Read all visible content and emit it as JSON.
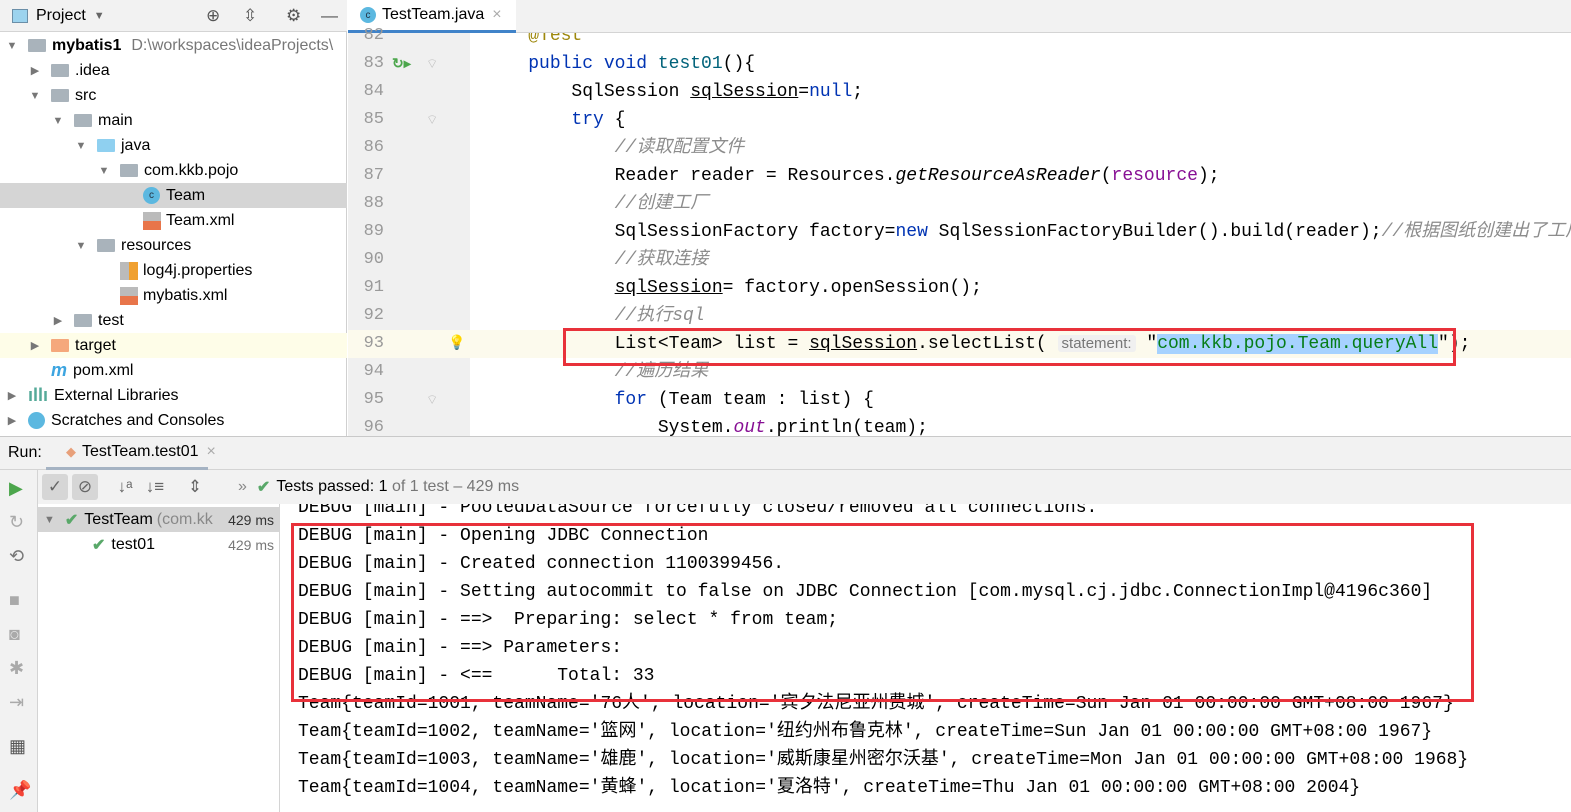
{
  "project": {
    "title": "Project",
    "tree": [
      {
        "label": "mybatis1",
        "path": "D:\\workspaces\\ideaProjects\\",
        "depth": 0,
        "arrow": "down",
        "icon": "module",
        "bold": true
      },
      {
        "label": ".idea",
        "depth": 1,
        "arrow": "right",
        "icon": "folder"
      },
      {
        "label": "src",
        "depth": 1,
        "arrow": "down",
        "icon": "folder"
      },
      {
        "label": "main",
        "depth": 2,
        "arrow": "down",
        "icon": "folder"
      },
      {
        "label": "java",
        "depth": 3,
        "arrow": "down",
        "icon": "folder-blue"
      },
      {
        "label": "com.kkb.pojo",
        "depth": 4,
        "arrow": "down",
        "icon": "package"
      },
      {
        "label": "Team",
        "depth": 5,
        "arrow": "",
        "icon": "class",
        "selected": true
      },
      {
        "label": "Team.xml",
        "depth": 5,
        "arrow": "",
        "icon": "xml"
      },
      {
        "label": "resources",
        "depth": 3,
        "arrow": "down",
        "icon": "folder"
      },
      {
        "label": "log4j.properties",
        "depth": 4,
        "arrow": "",
        "icon": "properties"
      },
      {
        "label": "mybatis.xml",
        "depth": 4,
        "arrow": "",
        "icon": "xml"
      },
      {
        "label": "test",
        "depth": 2,
        "arrow": "right",
        "icon": "folder"
      },
      {
        "label": "target",
        "depth": 1,
        "arrow": "right",
        "icon": "folder-orange",
        "highlight": true
      },
      {
        "label": "pom.xml",
        "depth": 1,
        "arrow": "",
        "icon": "maven"
      },
      {
        "label": "External Libraries",
        "depth": 0,
        "arrow": "right",
        "icon": "libraries"
      },
      {
        "label": "Scratches and Consoles",
        "depth": 0,
        "arrow": "right",
        "icon": "scratches"
      }
    ]
  },
  "editor": {
    "tab": "TestTeam.java",
    "current_line": 93,
    "lines": [
      {
        "n": 82,
        "seg": [
          [
            "    ",
            ""
          ],
          [
            "@Test",
            "an"
          ]
        ]
      },
      {
        "n": 83,
        "seg": [
          [
            "    ",
            ""
          ],
          [
            "public void ",
            "kw"
          ],
          [
            "test01",
            "fn"
          ],
          [
            "(){",
            ""
          ]
        ]
      },
      {
        "n": 84,
        "seg": [
          [
            "        SqlSession ",
            ""
          ],
          [
            "sqlSession",
            "ul"
          ],
          [
            "=",
            ""
          ],
          [
            "null",
            "kw"
          ],
          [
            ";",
            ""
          ]
        ]
      },
      {
        "n": 85,
        "seg": [
          [
            "        ",
            ""
          ],
          [
            "try",
            "kw"
          ],
          [
            " {",
            ""
          ]
        ]
      },
      {
        "n": 86,
        "seg": [
          [
            "            ",
            ""
          ],
          [
            "//读取配置文件",
            "cm"
          ]
        ]
      },
      {
        "n": 87,
        "seg": [
          [
            "            Reader reader = Resources.",
            ""
          ],
          [
            "getResourceAsReader",
            "it"
          ],
          [
            "(",
            ""
          ],
          [
            "resource",
            "fld"
          ],
          [
            ");",
            ""
          ]
        ]
      },
      {
        "n": 88,
        "seg": [
          [
            "            ",
            ""
          ],
          [
            "//创建工厂",
            "cm"
          ]
        ]
      },
      {
        "n": 89,
        "seg": [
          [
            "            SqlSessionFactory factory=",
            ""
          ],
          [
            "new",
            "kw"
          ],
          [
            " SqlSessionFactoryBuilder().build(reader);",
            ""
          ],
          [
            "//根据图纸创建出了工厂",
            "cm"
          ]
        ]
      },
      {
        "n": 90,
        "seg": [
          [
            "            ",
            ""
          ],
          [
            "//获取连接",
            "cm"
          ]
        ]
      },
      {
        "n": 91,
        "seg": [
          [
            "            ",
            ""
          ],
          [
            "sqlSession",
            "ul"
          ],
          [
            "= factory.openSession();",
            ""
          ]
        ]
      },
      {
        "n": 92,
        "seg": [
          [
            "            ",
            ""
          ],
          [
            "//执行sql",
            "cm"
          ]
        ]
      },
      {
        "n": 93,
        "seg": [
          [
            "            List<Team> list = ",
            ""
          ],
          [
            "sqlSession",
            "ul"
          ],
          [
            ".selectList( ",
            ""
          ],
          [
            "statement:",
            "hint"
          ],
          [
            " \"",
            ""
          ],
          [
            "com.kkb.pojo.Team.queryAll",
            "st selbg"
          ],
          [
            "\");",
            ""
          ]
        ]
      },
      {
        "n": 94,
        "seg": [
          [
            "            ",
            ""
          ],
          [
            "//遍历结果",
            "cm"
          ]
        ]
      },
      {
        "n": 95,
        "seg": [
          [
            "            ",
            ""
          ],
          [
            "for",
            "kw"
          ],
          [
            " (Team team : list) {",
            ""
          ]
        ]
      },
      {
        "n": 96,
        "seg": [
          [
            "                System.",
            ""
          ],
          [
            "out",
            "fld it"
          ],
          [
            ".println(team);",
            ""
          ]
        ]
      }
    ]
  },
  "run": {
    "label": "Run:",
    "tab": "TestTeam.test01",
    "status_prefix": "Tests passed:",
    "status_count": "1",
    "status_suffix": "of 1 test – 429 ms",
    "tests": [
      {
        "label": "TestTeam",
        "detail": "(com.kk",
        "time": "429 ms"
      },
      {
        "label": "test01",
        "time": "429 ms"
      }
    ],
    "console": [
      "DEBUG [main] - PooledDataSource forcefully closed/removed all connections.",
      "DEBUG [main] - Opening JDBC Connection",
      "DEBUG [main] - Created connection 1100399456.",
      "DEBUG [main] - Setting autocommit to false on JDBC Connection [com.mysql.cj.jdbc.ConnectionImpl@4196c360]",
      "DEBUG [main] - ==>  Preparing: select * from team;",
      "DEBUG [main] - ==> Parameters: ",
      "DEBUG [main] - <==      Total: 33",
      "Team{teamId=1001, teamName='76人', location='宾夕法尼亚州费城', createTime=Sun Jan 01 00:00:00 GMT+08:00 1967}",
      "Team{teamId=1002, teamName='篮网', location='纽约州布鲁克林', createTime=Sun Jan 01 00:00:00 GMT+08:00 1967}",
      "Team{teamId=1003, teamName='雄鹿', location='威斯康星州密尔沃基', createTime=Mon Jan 01 00:00:00 GMT+08:00 1968}",
      "Team{teamId=1004, teamName='黄蜂', location='夏洛特', createTime=Thu Jan 01 00:00:00 GMT+08:00 2004}"
    ]
  },
  "colors": {
    "accent": "#4083c9",
    "highlight_box": "#e8313a",
    "pass": "#59a869"
  }
}
